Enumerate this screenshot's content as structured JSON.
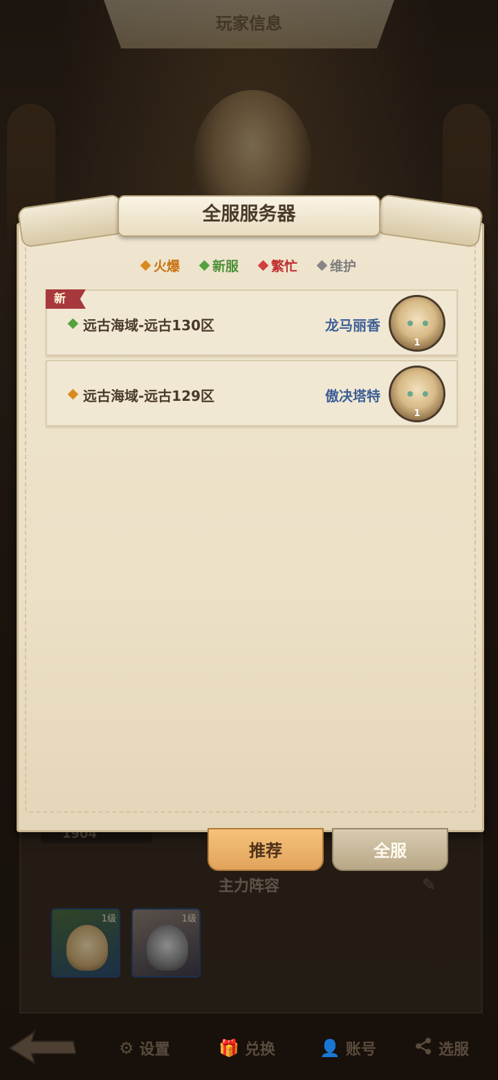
{
  "background": {
    "page_title": "玩家信息",
    "stat_value": "1904",
    "formation_title": "主力阵容",
    "heroes": [
      {
        "level": "1级"
      },
      {
        "level": "1级"
      }
    ]
  },
  "modal": {
    "title": "全服服务器",
    "legend": [
      {
        "label": "火爆",
        "color": "#d98a1e"
      },
      {
        "label": "新服",
        "color": "#54a23e"
      },
      {
        "label": "繁忙",
        "color": "#d04040"
      },
      {
        "label": "维护",
        "color": "#858585"
      }
    ],
    "servers": [
      {
        "tag": "新",
        "status_color": "#54a23e",
        "name": "远古海域-远古130区",
        "character": "龙马丽香",
        "avatar_level": "1"
      },
      {
        "status_color": "#d98a1e",
        "name": "远古海域-远古129区",
        "character": "傲决塔特",
        "avatar_level": "1"
      }
    ],
    "tabs": {
      "recommended": "推荐",
      "all": "全服"
    }
  },
  "bottom_nav": {
    "back_icon": "back-arrow-icon",
    "items": [
      {
        "label": "设置",
        "icon": "gear-icon"
      },
      {
        "label": "兑换",
        "icon": "gift-icon"
      },
      {
        "label": "账号",
        "icon": "user-icon"
      },
      {
        "label": "选服",
        "icon": "share-icon"
      }
    ]
  }
}
